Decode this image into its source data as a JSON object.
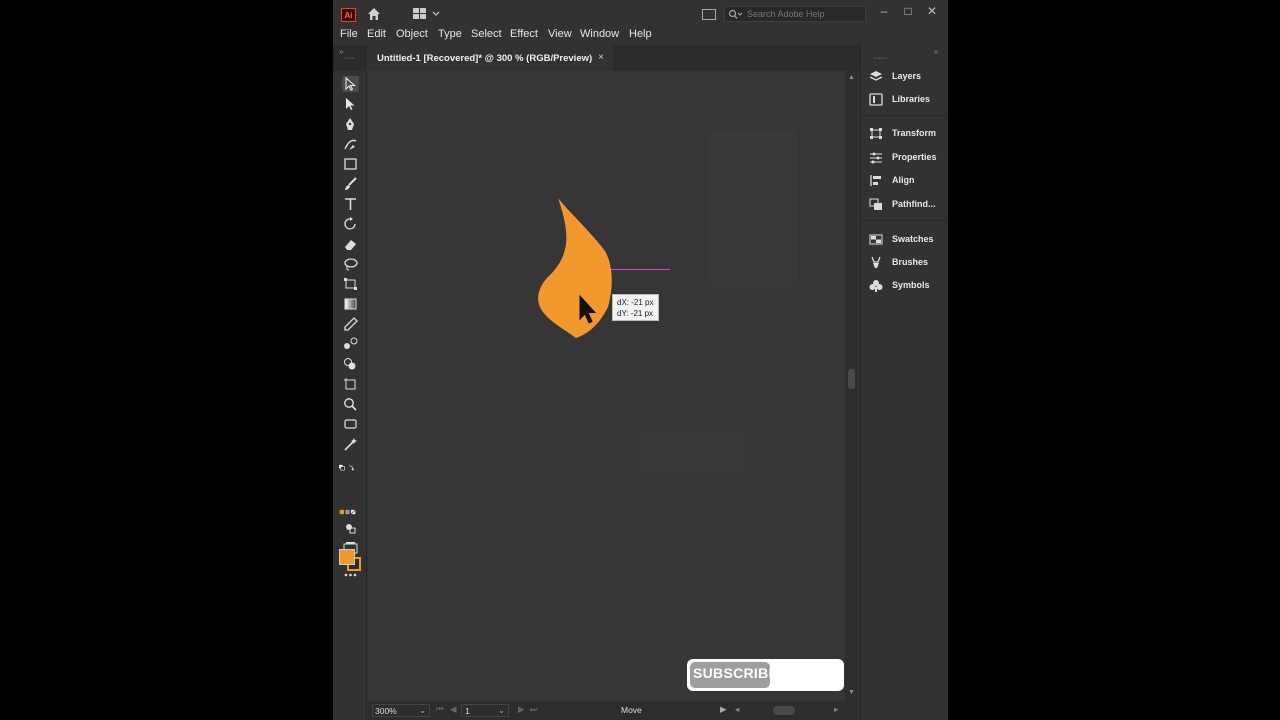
{
  "app": {
    "logo_text": "Ai",
    "search_placeholder": "Search Adobe Help",
    "window_controls": {
      "minimize": "–",
      "maximize": "□",
      "close": "✕"
    }
  },
  "menu": [
    "File",
    "Edit",
    "Object",
    "Type",
    "Select",
    "Effect",
    "View",
    "Window",
    "Help"
  ],
  "document_tab": {
    "title": "Untitled-1 [Recovered]* @ 300 % (RGB/Preview)",
    "close": "×"
  },
  "tools": [
    "selection-tool-icon",
    "direct-selection-tool-icon",
    "pen-tool-icon",
    "curvature-tool-icon",
    "rectangle-tool-icon",
    "paintbrush-tool-icon",
    "type-tool-icon",
    "rotate-tool-icon",
    "eraser-tool-icon",
    "lasso-tool-icon",
    "free-transform-tool-icon",
    "gradient-tool-icon",
    "eyedropper-tool-icon",
    "blend-tool-icon",
    "shape-builder-tool-icon",
    "artboard-tool-icon",
    "zoom-tool-icon",
    "frame-tool-icon",
    "magic-wand-tool-icon"
  ],
  "colors": {
    "fill": "#f3982c",
    "smart_guide": "#e23ad6",
    "ui_background": "#323232"
  },
  "tooltip": {
    "dx": "dX: -21 px",
    "dy": "dY: -21 px"
  },
  "status": {
    "zoom": "300%",
    "page": "1",
    "current_tool": "Move"
  },
  "panels": [
    {
      "label": "Layers",
      "icon": "layers-icon"
    },
    {
      "label": "Libraries",
      "icon": "libraries-icon"
    },
    {
      "label": "Transform",
      "icon": "transform-icon"
    },
    {
      "label": "Properties",
      "icon": "properties-icon"
    },
    {
      "label": "Align",
      "icon": "align-icon"
    },
    {
      "label": "Pathfind...",
      "icon": "pathfinder-icon"
    },
    {
      "label": "Swatches",
      "icon": "swatches-icon"
    },
    {
      "label": "Brushes",
      "icon": "brushes-icon"
    },
    {
      "label": "Symbols",
      "icon": "symbols-icon"
    }
  ],
  "overlay": {
    "subscribe_label": "SUBSCRIBE"
  }
}
